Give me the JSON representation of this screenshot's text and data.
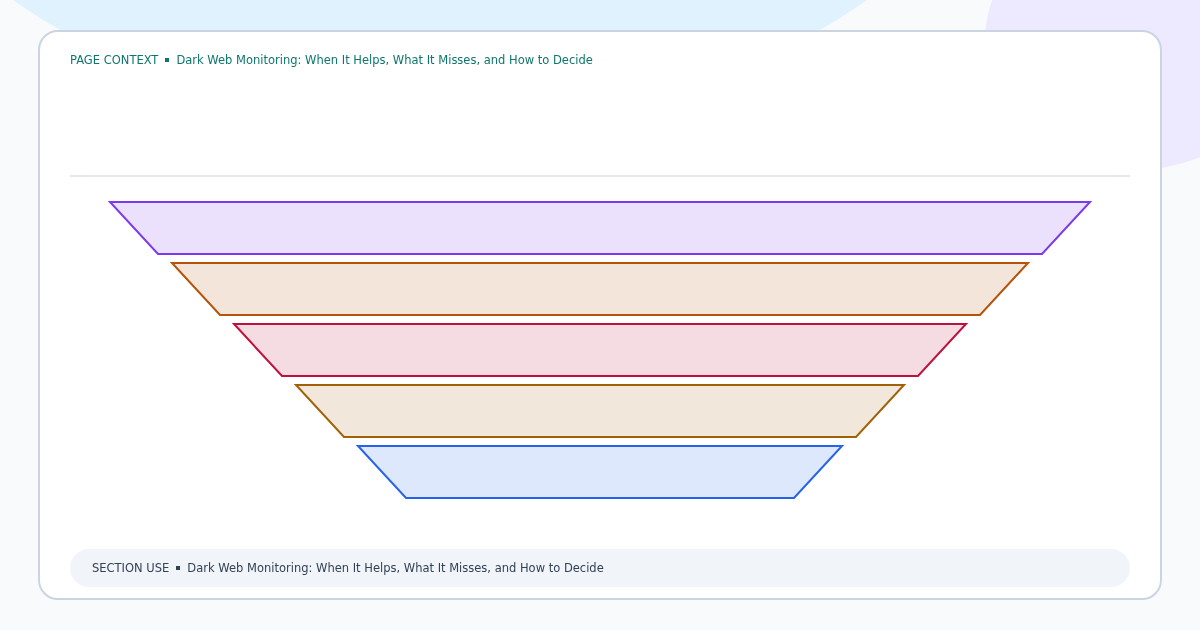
{
  "header": {
    "label": "PAGE CONTEXT",
    "title": "Dark Web Monitoring: When It Helps, What It Misses, and How to Decide"
  },
  "funnel": {
    "stages": [
      {
        "color": "#7c3aed"
      },
      {
        "color": "#b45309"
      },
      {
        "color": "#be123c"
      },
      {
        "color": "#a16207"
      },
      {
        "color": "#2563eb"
      }
    ]
  },
  "footer": {
    "label": "SECTION USE",
    "title": "Dark Web Monitoring: When It Helps, What It Misses, and How to Decide"
  }
}
